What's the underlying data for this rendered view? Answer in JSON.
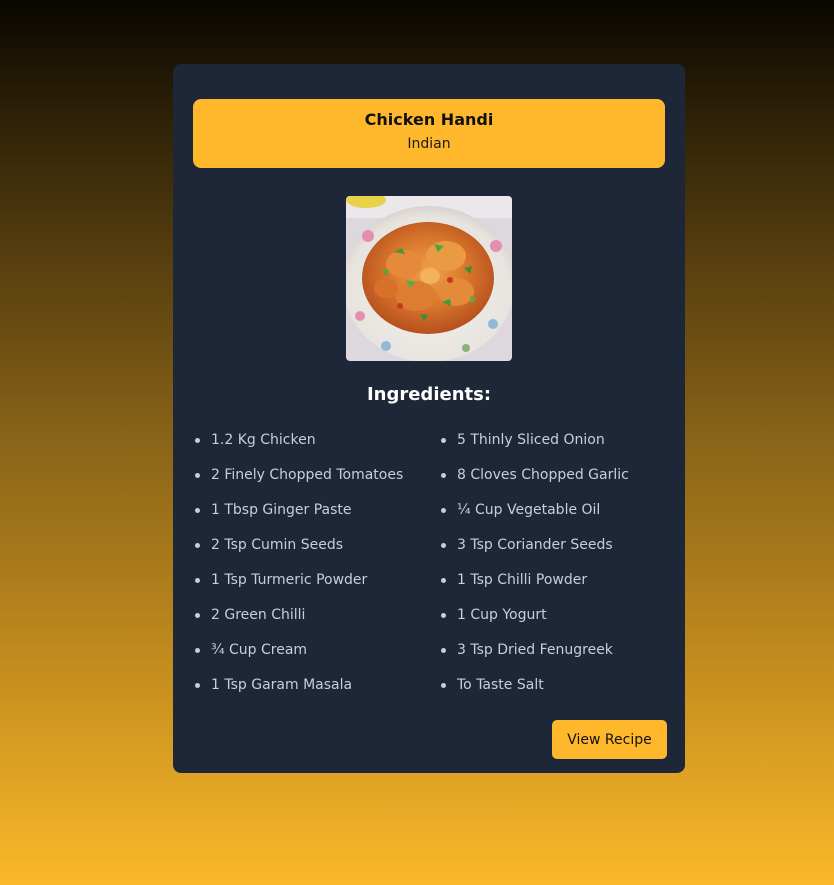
{
  "recipe": {
    "title": "Chicken Handi",
    "cuisine": "Indian",
    "image_alt": "Chicken Handi dish",
    "ingredients_heading": "Ingredients:",
    "ingredients_left": [
      "1.2 Kg Chicken",
      "2 Finely Chopped Tomatoes",
      "1 Tbsp Ginger Paste",
      "2 Tsp Cumin Seeds",
      "1 Tsp Turmeric Powder",
      "2 Green Chilli",
      "¾ Cup Cream",
      "1 Tsp Garam Masala"
    ],
    "ingredients_right": [
      "5 Thinly Sliced Onion",
      "8 Cloves Chopped Garlic",
      "¼ Cup Vegetable Oil",
      "3 Tsp Coriander Seeds",
      "1 Tsp Chilli Powder",
      "1 Cup Yogurt",
      "3 Tsp Dried Fenugreek",
      "To Taste Salt"
    ],
    "view_button_label": "View Recipe"
  },
  "colors": {
    "accent": "#ffb82b",
    "card_background": "#1e2738",
    "ingredient_text": "#c9ced8"
  }
}
